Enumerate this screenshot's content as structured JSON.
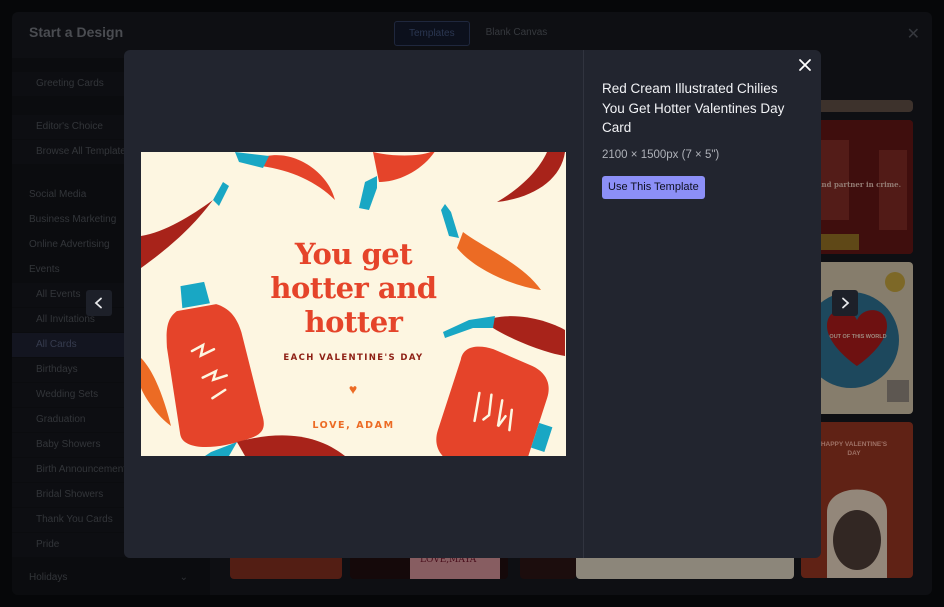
{
  "background": {
    "title": "Start a Design",
    "tabs": [
      {
        "label": "Templates"
      },
      {
        "label": "Blank Canvas"
      }
    ],
    "sidebar": {
      "items": [
        {
          "label": "Greeting Cards"
        },
        {
          "label": "Editor's Choice"
        },
        {
          "label": "Browse All Templates"
        },
        {
          "label": "Social Media"
        },
        {
          "label": "Business Marketing"
        },
        {
          "label": "Online Advertising"
        },
        {
          "label": "Events"
        },
        {
          "label": "All Events"
        },
        {
          "label": "All Invitations"
        },
        {
          "label": "All Cards"
        },
        {
          "label": "Birthdays"
        },
        {
          "label": "Wedding Sets"
        },
        {
          "label": "Graduation"
        },
        {
          "label": "Baby Showers"
        },
        {
          "label": "Birth Announcements"
        },
        {
          "label": "Bridal Showers"
        },
        {
          "label": "Thank You Cards"
        },
        {
          "label": "Pride"
        },
        {
          "label": "Holidays"
        }
      ]
    },
    "peek_texts": {
      "partner_crime": "and partner in crime.",
      "out_of_world": "OUT OF THIS WORLD",
      "happy_valentines": "HAPPY VALENTINE'S DAY",
      "love_maya": "LOVE,MAYA"
    }
  },
  "modal": {
    "title": "Red Cream Illustrated Chilies You Get Hotter Valentines Day Card",
    "dimensions": "2100 × 1500px (7 × 5\")",
    "use_button": "Use This Template",
    "card": {
      "headline_line1": "You get",
      "headline_line2": "hotter and",
      "headline_line3": "hotter",
      "subline": "EACH VALENTINE'S DAY",
      "heart": "♥",
      "signature": "LOVE, ADAM"
    }
  },
  "colors": {
    "modal_bg": "#22252f",
    "accent_button": "#8c8ff7",
    "card_bg": "#fdf6e1",
    "card_red": "#e5442a",
    "card_dark_red": "#8e2015",
    "card_orange": "#ec6b24",
    "card_teal": "#19a7c4"
  },
  "icons": {
    "close": "close-icon",
    "prev": "chevron-left-icon",
    "next": "chevron-right-icon",
    "expand": "chevron-down-icon"
  }
}
